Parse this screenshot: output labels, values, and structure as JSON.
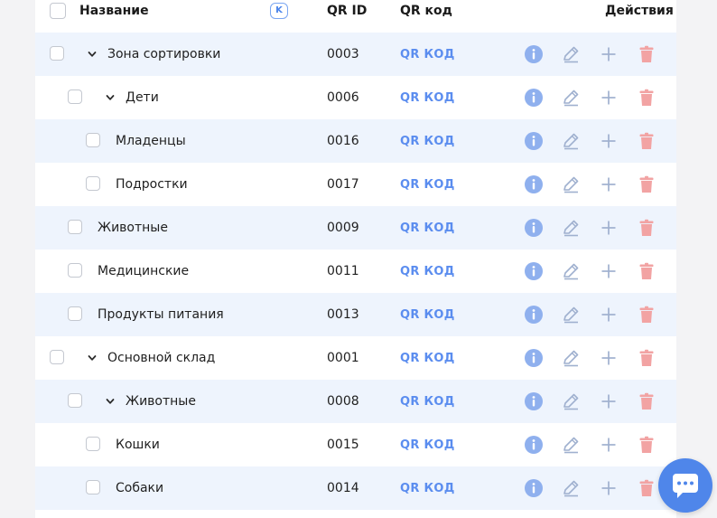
{
  "header": {
    "name_label": "Название",
    "sort_badge": "K",
    "qr_id_label": "QR ID",
    "qr_code_label": "QR код",
    "actions_label": "Действия"
  },
  "rows": [
    {
      "name": "Зона сортировки",
      "qr_id": "0003",
      "qr_link": "QR КОД",
      "level": 0,
      "expandable": true
    },
    {
      "name": "Дети",
      "qr_id": "0006",
      "qr_link": "QR КОД",
      "level": 1,
      "expandable": true
    },
    {
      "name": "Младенцы",
      "qr_id": "0016",
      "qr_link": "QR КОД",
      "level": 2,
      "expandable": false
    },
    {
      "name": "Подростки",
      "qr_id": "0017",
      "qr_link": "QR КОД",
      "level": 2,
      "expandable": false
    },
    {
      "name": "Животные",
      "qr_id": "0009",
      "qr_link": "QR КОД",
      "level": 1,
      "expandable": false
    },
    {
      "name": "Медицинские",
      "qr_id": "0011",
      "qr_link": "QR КОД",
      "level": 1,
      "expandable": false
    },
    {
      "name": "Продукты питания",
      "qr_id": "0013",
      "qr_link": "QR КОД",
      "level": 1,
      "expandable": false
    },
    {
      "name": "Основной склад",
      "qr_id": "0001",
      "qr_link": "QR КОД",
      "level": 0,
      "expandable": true
    },
    {
      "name": "Животные",
      "qr_id": "0008",
      "qr_link": "QR КОД",
      "level": 1,
      "expandable": true
    },
    {
      "name": "Кошки",
      "qr_id": "0015",
      "qr_link": "QR КОД",
      "level": 2,
      "expandable": false
    },
    {
      "name": "Собаки",
      "qr_id": "0014",
      "qr_link": "QR КОД",
      "level": 2,
      "expandable": false
    }
  ],
  "colors": {
    "accent": "#5b8def",
    "row_alt": "#eef4fd",
    "info_icon": "#8fb0ee",
    "edit_icon": "#9fb0cf",
    "add_icon": "#9fb0cf",
    "delete_icon": "#f2a3a3",
    "chat_button": "#4f86ea"
  },
  "icons": {
    "row_actions": [
      "info-icon",
      "edit-icon",
      "plus-icon",
      "trash-icon"
    ],
    "chat": "chat-icon",
    "expand": "chevron-down-icon"
  }
}
